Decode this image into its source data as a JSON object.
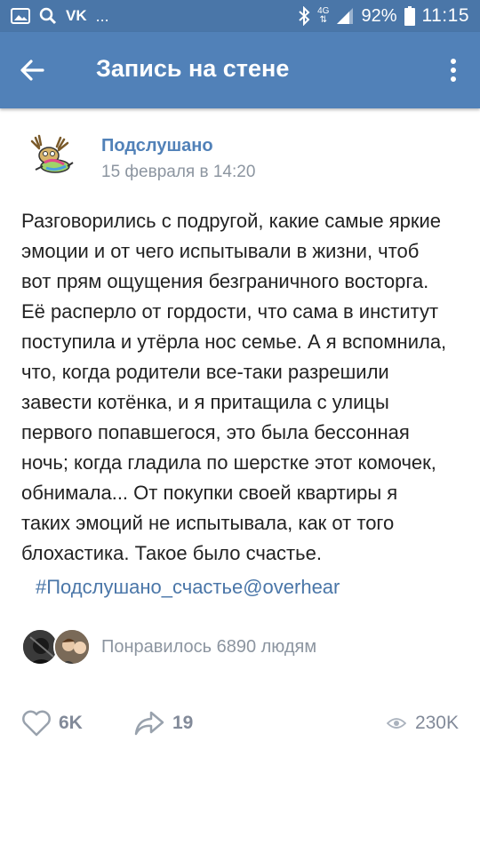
{
  "status_bar": {
    "app_label": "VK",
    "more": "...",
    "network": "4G",
    "battery": "92%",
    "time": "11:15"
  },
  "app_bar": {
    "title": "Запись на стене"
  },
  "post": {
    "author": "Подслушано",
    "date": "15 февраля в 14:20",
    "text": "Разговорились с подругой, какие самые яркие\nэмоции и от чего испытывали в жизни, чтоб\nвот прям ощущения безграничного восторга.\nЕё расперло от гордости, что сама в институт\nпоступила и утёрла нос семье. А я вспомнила,\nчто, когда родители все-таки разрешили\nзавести котёнка, и я притащила с улицы\nпервого попавшегося, это была бессонная\nночь; когда гладила по шерстке этот комочек,\nобнимала... От покупки своей квартиры я\nтаких эмоций не испытывала, как от того\nблохастика. Такое было счастье.",
    "hashtag": "#Подслушано_счастье@overhear",
    "likes_summary": "Понравилось 6890 людям"
  },
  "actions": {
    "likes": "6K",
    "shares": "19",
    "views": "230K"
  },
  "colors": {
    "status_bar": "#4a76a8",
    "app_bar": "#5181b8",
    "link": "#5181b8",
    "meta": "#8c95a0",
    "icon": "#828a99"
  }
}
